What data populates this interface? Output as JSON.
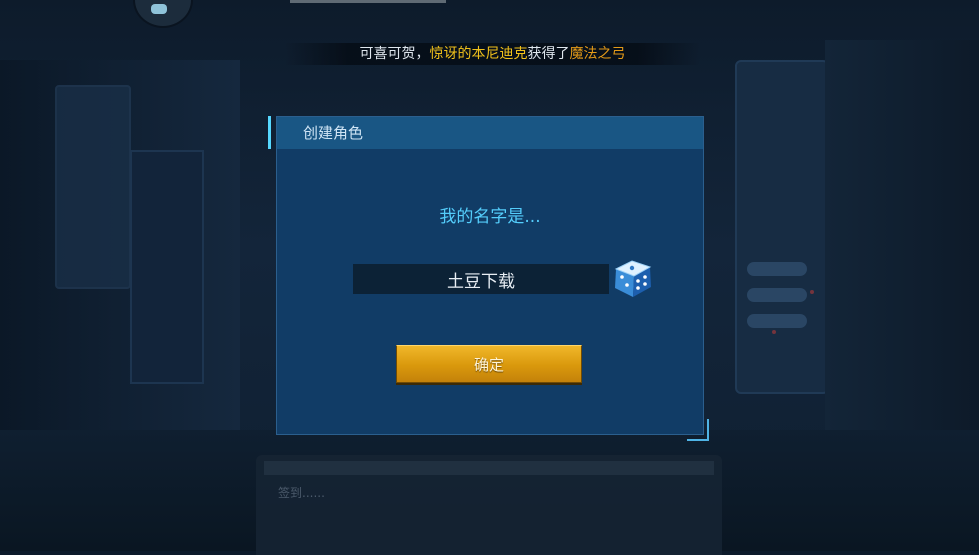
{
  "announcement": {
    "prefix": "可喜可贺，",
    "player": "惊讶的本尼迪克",
    "verb": "获得了",
    "item": "魔法之弓"
  },
  "dialog": {
    "title": "创建角色",
    "prompt": "我的名字是...",
    "name_value": "土豆下载",
    "confirm_label": "确定"
  },
  "chat": {
    "hint": "签到......"
  },
  "icons": {
    "dice": "dice-icon",
    "avatar": "avatar-icon"
  },
  "colors": {
    "prompt": "#54cdfb",
    "player_name": "#f1c21b",
    "item_name": "#e39a18",
    "confirm_button": "#e0a114",
    "dialog_bg": "#113c66"
  }
}
